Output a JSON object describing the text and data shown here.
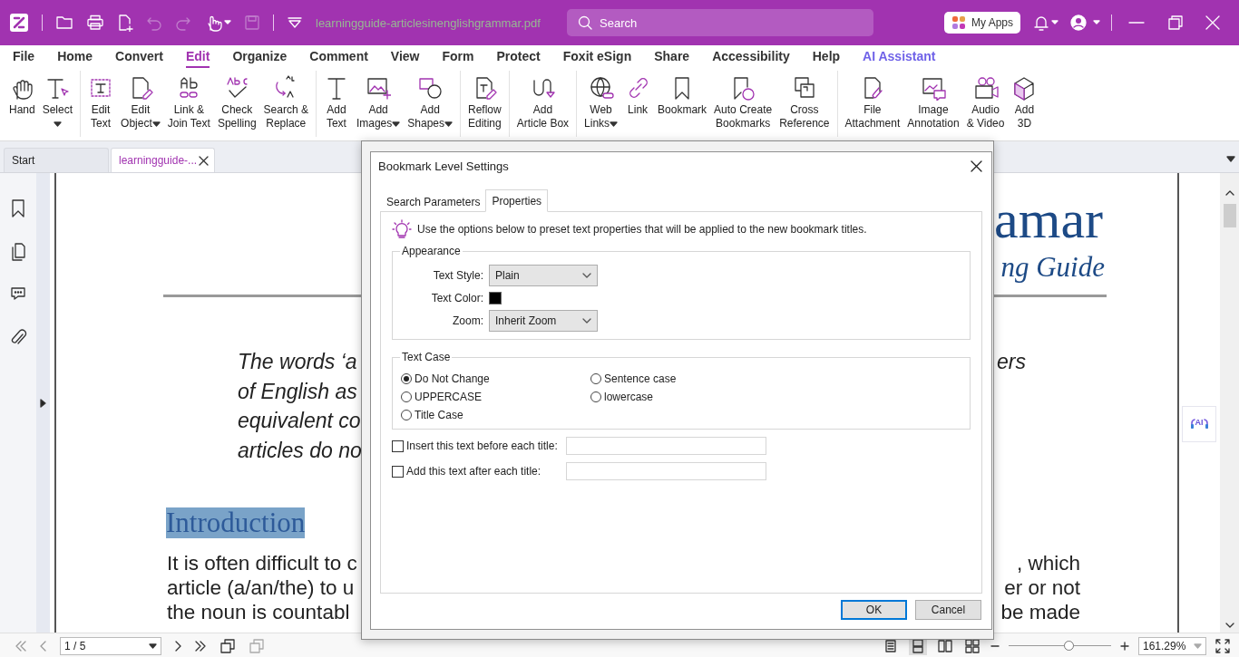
{
  "title_bar": {
    "file_name": "learningguide-articlesinenglishgrammar.pdf",
    "search": {
      "placeholder": "Search"
    },
    "apps_button": "My Apps"
  },
  "menu": [
    {
      "label": "File",
      "selected": false,
      "kind": "tab"
    },
    {
      "label": "Home",
      "selected": false,
      "kind": "tab"
    },
    {
      "label": "Convert",
      "selected": false,
      "kind": "tab"
    },
    {
      "label": "Edit",
      "selected": true,
      "kind": "tab"
    },
    {
      "label": "Organize",
      "selected": false,
      "kind": "tab"
    },
    {
      "label": "Comment",
      "selected": false,
      "kind": "tab"
    },
    {
      "label": "View",
      "selected": false,
      "kind": "tab"
    },
    {
      "label": "Form",
      "selected": false,
      "kind": "tab"
    },
    {
      "label": "Protect",
      "selected": false,
      "kind": "tab"
    },
    {
      "label": "Foxit eSign",
      "selected": false,
      "kind": "tab"
    },
    {
      "label": "Share",
      "selected": false,
      "kind": "tab"
    },
    {
      "label": "Accessibility",
      "selected": false,
      "kind": "tab"
    },
    {
      "label": "Help",
      "selected": false,
      "kind": "tab"
    },
    {
      "label": "AI Assistant",
      "selected": false,
      "kind": "ai"
    }
  ],
  "ribbon": {
    "groups": [
      [
        {
          "label": "Hand",
          "dropdown": false
        },
        {
          "label": "Select",
          "dropdown": true
        }
      ],
      [
        {
          "label": "Edit\nText",
          "dropdown": false
        },
        {
          "label": "Edit\nObject",
          "dropdown": true
        },
        {
          "label": "Link &\nJoin Text",
          "dropdown": false
        },
        {
          "label": "Check\nSpelling",
          "dropdown": false
        },
        {
          "label": "Search &\nReplace",
          "dropdown": false
        }
      ],
      [
        {
          "label": "Add\nText",
          "dropdown": false
        },
        {
          "label": "Add\nImages",
          "dropdown": true
        },
        {
          "label": "Add\nShapes",
          "dropdown": true
        }
      ],
      [
        {
          "label": "Reflow\nEditing",
          "dropdown": false
        }
      ],
      [
        {
          "label": "Add\nArticle Box",
          "dropdown": false
        }
      ],
      [
        {
          "label": "Web\nLinks",
          "dropdown": true
        },
        {
          "label": "Link",
          "dropdown": false
        },
        {
          "label": "Bookmark",
          "dropdown": false
        },
        {
          "label": "Auto Create\nBookmarks",
          "dropdown": false
        },
        {
          "label": "Cross\nReference",
          "dropdown": false
        }
      ],
      [
        {
          "label": "File\nAttachment",
          "dropdown": false
        },
        {
          "label": "Image\nAnnotation",
          "dropdown": false
        },
        {
          "label": "Audio\n& Video",
          "dropdown": false
        },
        {
          "label": "Add\n3D",
          "dropdown": false
        }
      ]
    ]
  },
  "doc_tabs": [
    {
      "label": "Start",
      "selected": false,
      "closable": false
    },
    {
      "label": "learningguide-...",
      "selected": true,
      "closable": true
    }
  ],
  "document": {
    "title_fragment": "amar",
    "subtitle_fragment": "ng Guide",
    "quote_lines": [
      {
        "left": "The words ‘a",
        "right": "ers"
      },
      {
        "left": "of English as"
      },
      {
        "left": "equivalent co"
      },
      {
        "left": "articles do no"
      }
    ],
    "heading": "Introduction",
    "heading_selected": true,
    "paragraph_lines": [
      {
        "left": "It is often difficult to c",
        "right": ", which"
      },
      {
        "left": "article (a/an/the) to u",
        "right": "er or not"
      },
      {
        "left": "the noun is countabl",
        "right": "be made"
      }
    ],
    "ai_button": "AI"
  },
  "dialog": {
    "title": "Bookmark Level Settings",
    "tabs": [
      {
        "label": "Search Parameters",
        "selected": false
      },
      {
        "label": "Properties",
        "selected": true
      }
    ],
    "hint": "Use the options below to preset text properties that will be applied to the new bookmark titles.",
    "appearance": {
      "legend": "Appearance",
      "text_style": {
        "label": "Text Style:",
        "value": "Plain"
      },
      "text_color": {
        "label": "Text Color:",
        "color": "#000000"
      },
      "zoom": {
        "label": "Zoom:",
        "value": "Inherit Zoom"
      }
    },
    "text_case": {
      "legend": "Text Case",
      "options": [
        {
          "label": "Do Not Change",
          "selected": true
        },
        {
          "label": "Sentence case",
          "selected": false
        },
        {
          "label": "UPPERCASE",
          "selected": false
        },
        {
          "label": "lowercase",
          "selected": false
        },
        {
          "label": "Title Case",
          "selected": false
        }
      ]
    },
    "affixes": [
      {
        "label": "Insert this text before each title:",
        "checked": false
      },
      {
        "label": "Add this text after each title:",
        "checked": false
      }
    ],
    "buttons": [
      {
        "label": "OK",
        "default": true
      },
      {
        "label": "Cancel",
        "default": false
      }
    ]
  },
  "status_bar": {
    "page_field": "1 / 5",
    "view_modes": [
      {
        "selected": false
      },
      {
        "selected": true
      },
      {
        "selected": false
      },
      {
        "selected": false
      }
    ],
    "zoom_slider": {
      "level": 0.58
    },
    "zoom_field": "161.29%"
  }
}
